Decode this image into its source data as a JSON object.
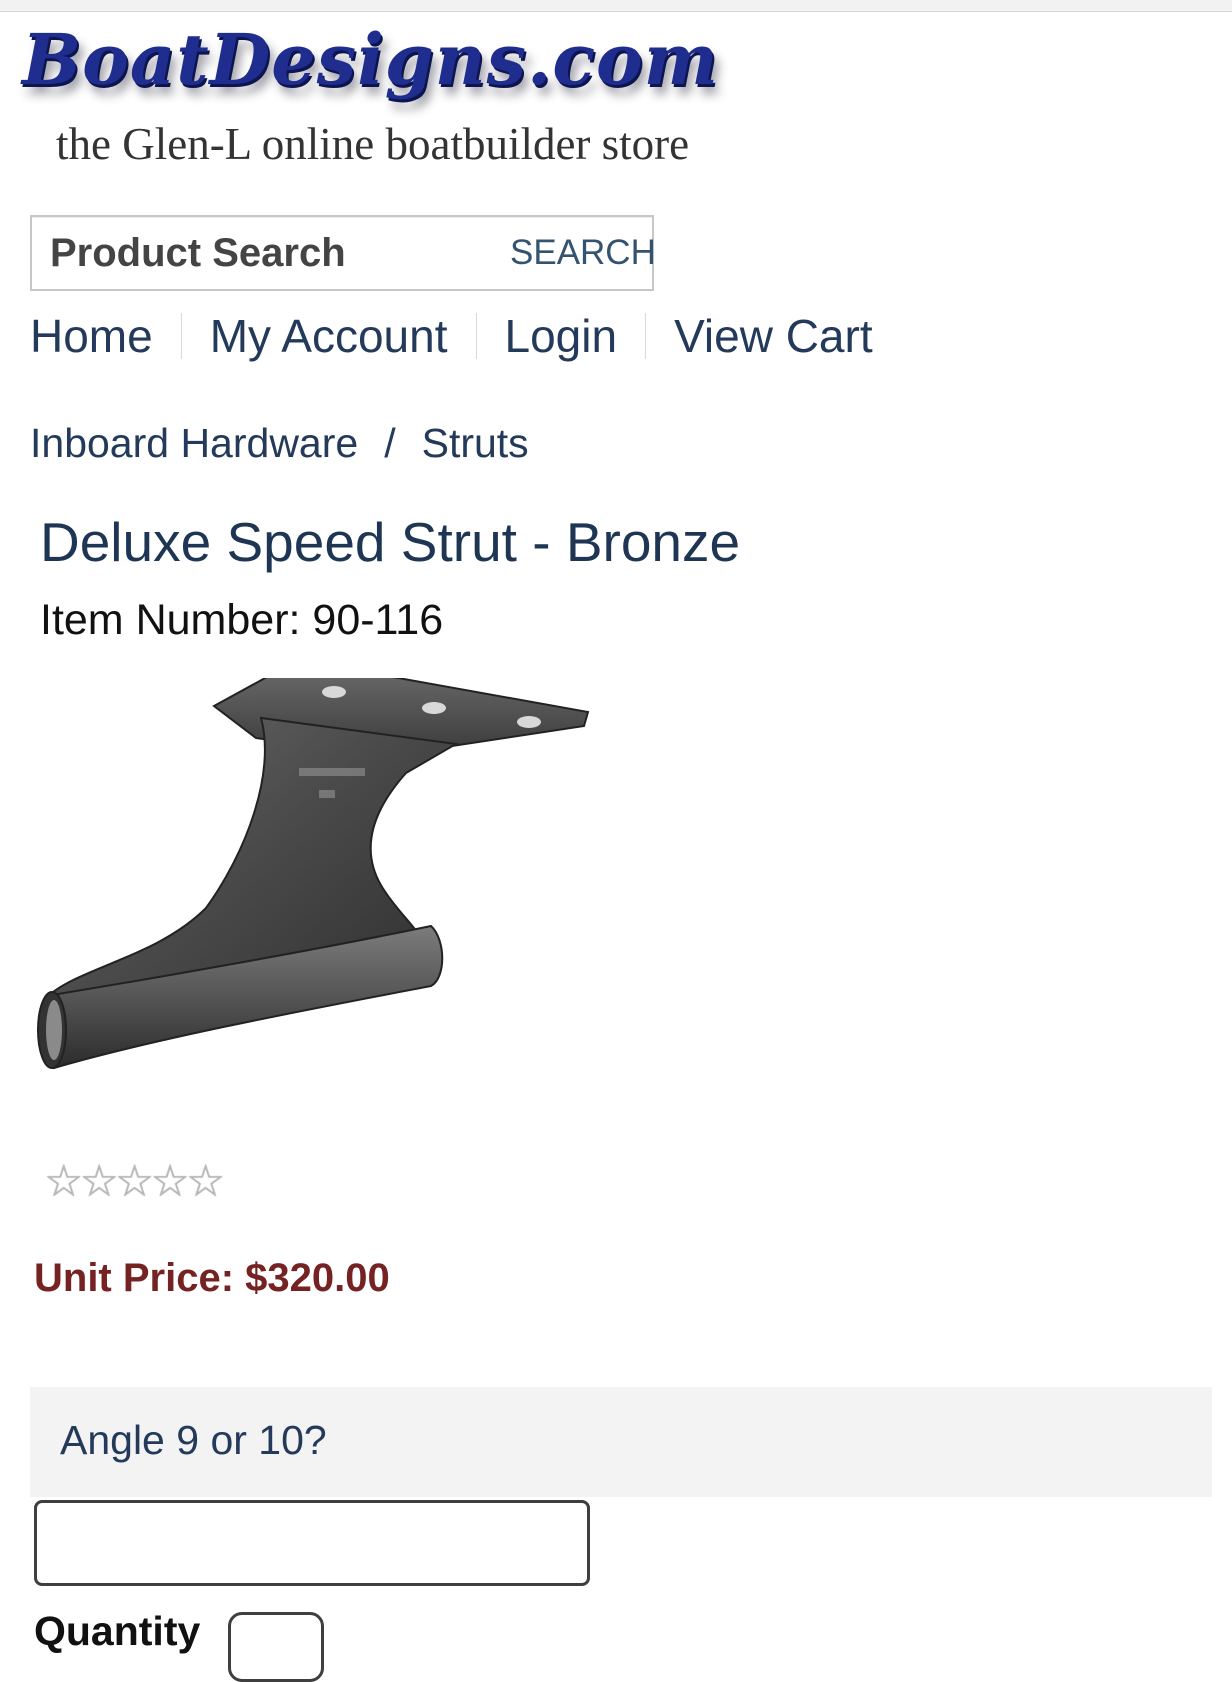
{
  "site": {
    "logo_text": "BoatDesigns.com",
    "tagline": "the Glen-L online boatbuilder store"
  },
  "search": {
    "placeholder": "Product Search",
    "button_label": "SEARCH"
  },
  "nav": {
    "items": [
      {
        "label": "Home"
      },
      {
        "label": "My Account"
      },
      {
        "label": "Login"
      },
      {
        "label": "View Cart"
      }
    ]
  },
  "breadcrumb": {
    "items": [
      {
        "label": "Inboard Hardware"
      },
      {
        "label": "Struts"
      }
    ],
    "separator": "/"
  },
  "product": {
    "title": "Deluxe Speed Strut - Bronze",
    "item_number_text": "Item Number: 90-116",
    "image_icon": "bronze-speed-strut-image",
    "rating": {
      "value": 0,
      "max": 5,
      "star_glyph": "☆"
    },
    "price_text": "Unit Price: $320.00",
    "price_color": "#742222"
  },
  "options": {
    "angle_label": "Angle 9 or 10?",
    "angle_value": "",
    "quantity_label": "Quantity",
    "quantity_value": ""
  },
  "colors": {
    "link": "#243a5a",
    "logo_blue": "#1f2d8f",
    "panel_bg": "#f3f3f3"
  }
}
